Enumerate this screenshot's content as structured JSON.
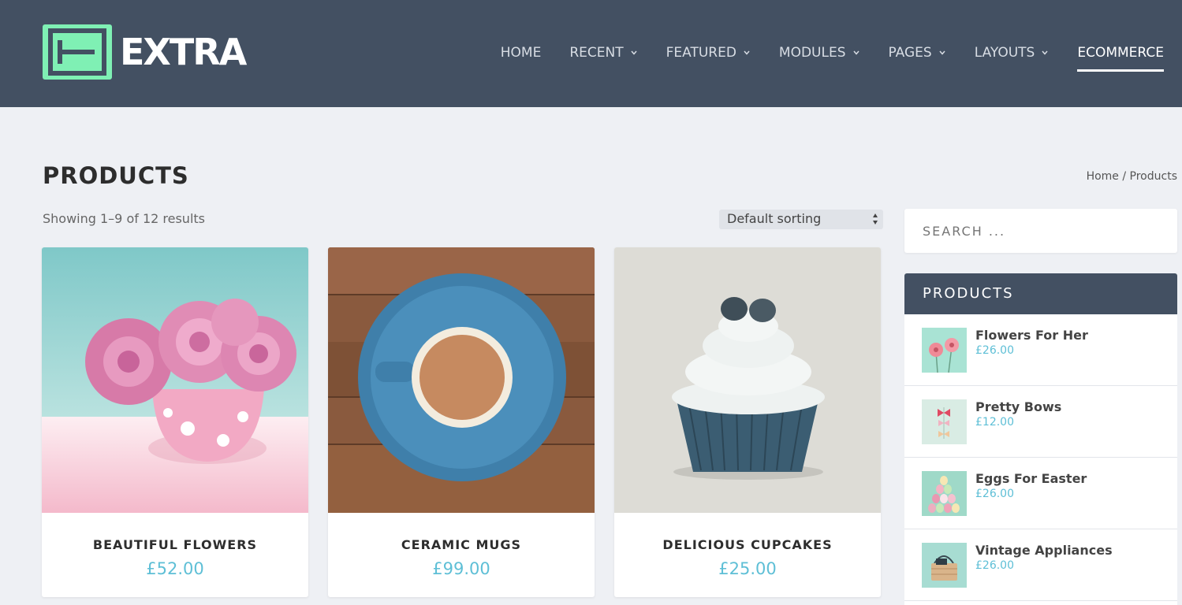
{
  "brand": {
    "logo_text": "EXTRA",
    "accent_color": "#7ff0b4",
    "header_bg": "#435062"
  },
  "nav": {
    "items": [
      {
        "label": "HOME",
        "has_dropdown": false,
        "active": false
      },
      {
        "label": "RECENT",
        "has_dropdown": true,
        "active": false
      },
      {
        "label": "FEATURED",
        "has_dropdown": true,
        "active": false
      },
      {
        "label": "MODULES",
        "has_dropdown": true,
        "active": false
      },
      {
        "label": "PAGES",
        "has_dropdown": true,
        "active": false
      },
      {
        "label": "LAYOUTS",
        "has_dropdown": true,
        "active": false
      },
      {
        "label": "ECOMMERCE",
        "has_dropdown": false,
        "active": true
      }
    ]
  },
  "page": {
    "title": "PRODUCTS",
    "breadcrumb": "Home / Products",
    "result_count": "Showing 1–9 of 12 results",
    "sort_selected": "Default sorting"
  },
  "products": [
    {
      "name": "BEAUTIFUL FLOWERS",
      "price": "£52.00"
    },
    {
      "name": "CERAMIC MUGS",
      "price": "£99.00"
    },
    {
      "name": "DELICIOUS CUPCAKES",
      "price": "£25.00"
    }
  ],
  "sidebar": {
    "search_placeholder": "SEARCH ...",
    "widget_title": "PRODUCTS",
    "items": [
      {
        "name": "Flowers For Her",
        "price": "£26.00"
      },
      {
        "name": "Pretty Bows",
        "price": "£12.00"
      },
      {
        "name": "Eggs For Easter",
        "price": "£26.00"
      },
      {
        "name": "Vintage Appliances",
        "price": "£26.00"
      }
    ]
  },
  "price_color": "#5ebfd6"
}
